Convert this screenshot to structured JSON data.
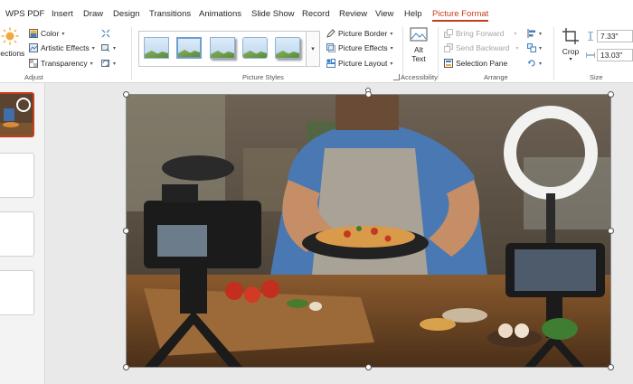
{
  "menubar": {
    "tabs": [
      {
        "label": "WPS PDF"
      },
      {
        "label": "Insert"
      },
      {
        "label": "Draw"
      },
      {
        "label": "Design"
      },
      {
        "label": "Transitions"
      },
      {
        "label": "Animations"
      },
      {
        "label": "Slide Show"
      },
      {
        "label": "Record"
      },
      {
        "label": "Review"
      },
      {
        "label": "View"
      },
      {
        "label": "Help"
      },
      {
        "label": "Picture Format"
      }
    ],
    "active_tab": "Picture Format"
  },
  "ribbon": {
    "adjust": {
      "corrections_label": "rrections",
      "color_label": "Color",
      "artistic_effects_label": "Artistic Effects",
      "transparency_label": "Transparency",
      "group_label": "Adjust"
    },
    "picture_styles": {
      "group_label": "Picture Styles",
      "border_label": "Picture Border",
      "effects_label": "Picture Effects",
      "layout_label": "Picture Layout"
    },
    "accessibility": {
      "alt_text_line1": "Alt",
      "alt_text_line2": "Text",
      "group_label": "Accessibility"
    },
    "arrange": {
      "bring_forward_label": "Bring Forward",
      "send_backward_label": "Send Backward",
      "selection_pane_label": "Selection Pane",
      "group_label": "Arrange"
    },
    "size": {
      "crop_label": "Crop",
      "height_value": "7.33\"",
      "width_value": "13.03\"",
      "group_label": "Size"
    }
  },
  "colors": {
    "accent": "#c43e1c",
    "ribbon_bg": "#ffffff",
    "canvas_bg": "#e9e9e9",
    "disabled_text": "#a6a6a6"
  }
}
